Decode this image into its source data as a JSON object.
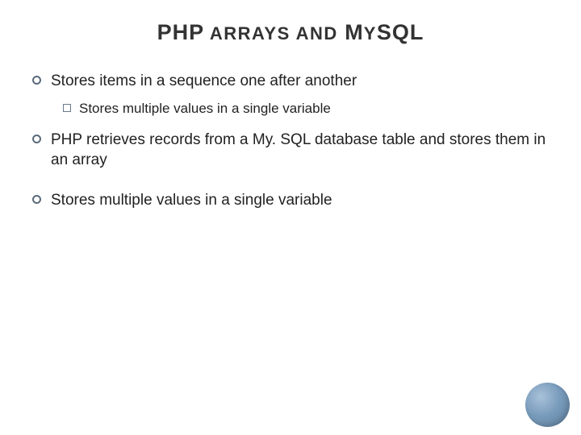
{
  "title": {
    "part1": "PHP",
    "part2_sc": " A",
    "part2": "RRAYS AND",
    "part3_sc": " M",
    "part3": "Y",
    "part4_sc": "SQL"
  },
  "bullets": [
    {
      "text": "Stores items in a sequence one after another",
      "sub": [
        {
          "text": "Stores multiple values in a single variable"
        }
      ]
    },
    {
      "text": "PHP retrieves records from a My. SQL database table and stores them in an array",
      "sub": []
    },
    {
      "text": "Stores multiple values in a single variable",
      "sub": []
    }
  ]
}
